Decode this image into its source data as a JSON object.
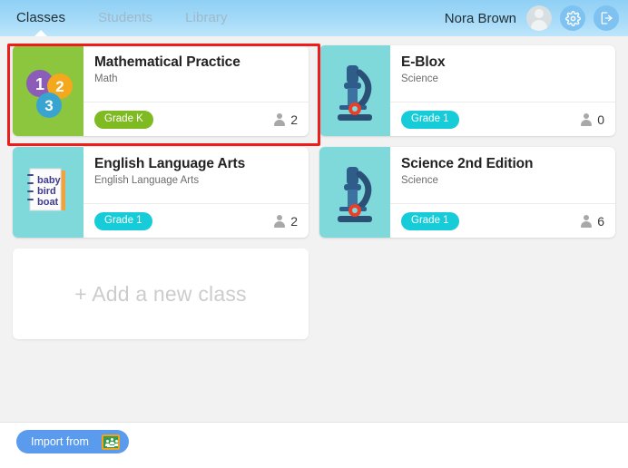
{
  "header": {
    "tabs": [
      {
        "label": "Classes",
        "active": true
      },
      {
        "label": "Students",
        "active": false
      },
      {
        "label": "Library",
        "active": false
      }
    ],
    "user_name": "Nora Brown",
    "avatar_icon": "user-avatar-icon",
    "settings_icon": "gear-icon",
    "logout_icon": "logout-icon"
  },
  "classes": [
    {
      "title": "Mathematical Practice",
      "subject": "Math",
      "grade": "Grade K",
      "grade_color": "#7fba22",
      "students": "2",
      "thumb_kind": "math-numbers",
      "thumb_bg": "#8cc63e",
      "selected": true,
      "numbers": [
        {
          "value": "1",
          "color": "#8b5cb8"
        },
        {
          "value": "2",
          "color": "#f4a81d"
        },
        {
          "value": "3",
          "color": "#3aa4d0"
        }
      ]
    },
    {
      "title": "E-Blox",
      "subject": "Science",
      "grade": "Grade 1",
      "grade_color": "#16ccd8",
      "students": "0",
      "thumb_kind": "microscope",
      "thumb_bg": "#7fd8da",
      "selected": false
    },
    {
      "title": "English Language Arts",
      "subject": "English Language Arts",
      "grade": "Grade 1",
      "grade_color": "#16ccd8",
      "students": "2",
      "thumb_kind": "notebook",
      "thumb_bg": "#7fd8da",
      "selected": false,
      "notebook_lines": [
        "baby",
        "bird",
        "boat"
      ]
    },
    {
      "title": "Science 2nd Edition",
      "subject": "Science",
      "grade": "Grade 1",
      "grade_color": "#16ccd8",
      "students": "6",
      "thumb_kind": "microscope",
      "thumb_bg": "#7fd8da",
      "selected": false
    }
  ],
  "add_class": {
    "label": "+ Add a new class"
  },
  "footer": {
    "import_label": "Import from",
    "import_icon": "google-classroom-icon"
  },
  "colors": {
    "header_blue": "#a5daf8",
    "page_bg": "#f2f2f2",
    "highlight_red": "#f01c1c",
    "import_blue": "#5b9bed"
  }
}
